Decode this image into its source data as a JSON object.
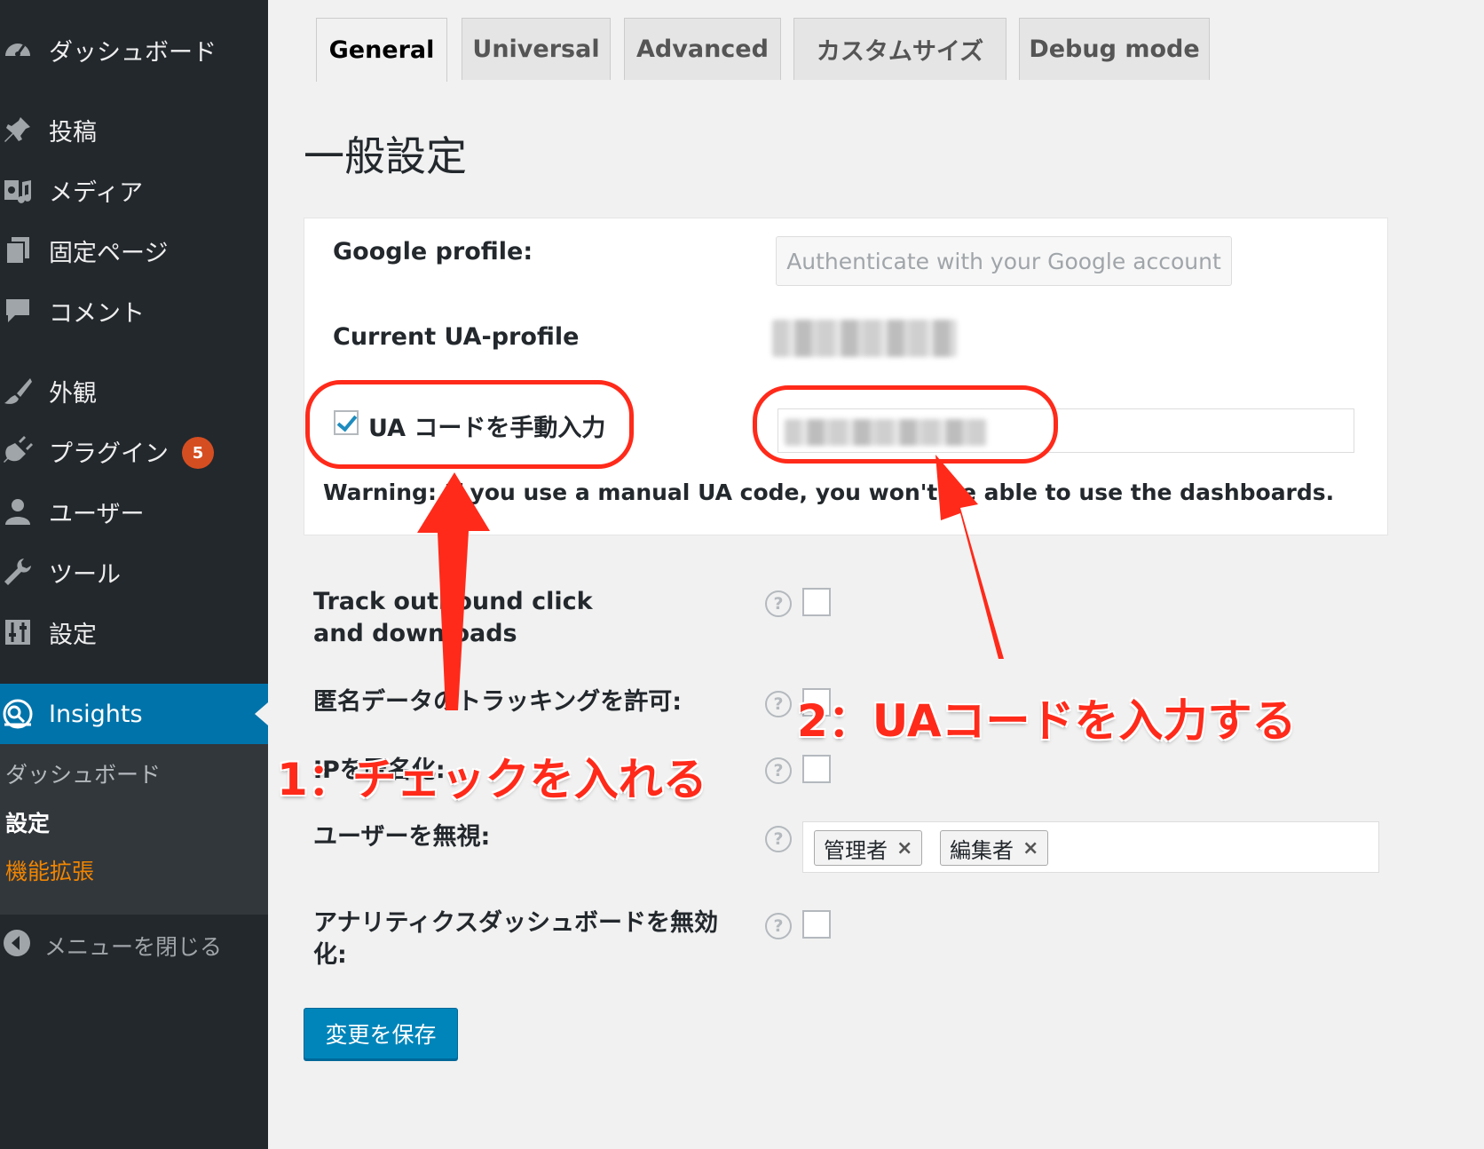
{
  "sidebar": {
    "items": [
      {
        "label": "ダッシュボード",
        "icon": "dashboard-icon"
      },
      {
        "label": "投稿",
        "icon": "pushpin-icon"
      },
      {
        "label": "メディア",
        "icon": "media-icon"
      },
      {
        "label": "固定ページ",
        "icon": "pages-icon"
      },
      {
        "label": "コメント",
        "icon": "comment-icon"
      },
      {
        "label": "外観",
        "icon": "paintbrush-icon"
      },
      {
        "label": "プラグイン",
        "icon": "plugin-icon",
        "badge": "5"
      },
      {
        "label": "ユーザー",
        "icon": "user-icon"
      },
      {
        "label": "ツール",
        "icon": "wrench-icon"
      },
      {
        "label": "設定",
        "icon": "settings-icon"
      }
    ],
    "active": {
      "label": "Insights",
      "icon": "insights-icon"
    },
    "submenu": [
      "ダッシュボード",
      "設定",
      "機能拡張"
    ],
    "collapse_label": "メニューを閉じる"
  },
  "tabs": [
    "General",
    "Universal",
    "Advanced",
    "カスタムサイズ",
    "Debug mode"
  ],
  "page_title": "一般設定",
  "google_profile": {
    "label": "Google profile:",
    "button": "Authenticate with your Google account"
  },
  "current_ua": {
    "label": "Current UA-profile"
  },
  "manual_ua": {
    "label": "UA コードを手動入力",
    "checked": true
  },
  "warning": "Warning: If you use a manual UA code, you won't be able to use the dashboards.",
  "options": {
    "track_outbound": "Track outbound click and downloads",
    "anonymous": "匿名データのトラッキングを許可:",
    "anonymize_ip": "IPを匿名化:",
    "ignore_users": "ユーザーを無視:",
    "ignore_users_tags": [
      "管理者",
      "編集者"
    ],
    "disable_dashboard": "アナリティクスダッシュボードを無効化:"
  },
  "help_glyph": "?",
  "remove_glyph": "×",
  "save_button": "変更を保存",
  "annotations": {
    "step1": "1：チェックを入れる",
    "step2": "2：UAコードを入力する"
  },
  "colors": {
    "accent": "#0073aa",
    "annotation": "#ff2a1a",
    "sidebar_bg": "#23282d",
    "badge": "#d54e21",
    "highlight": "#f18500"
  }
}
